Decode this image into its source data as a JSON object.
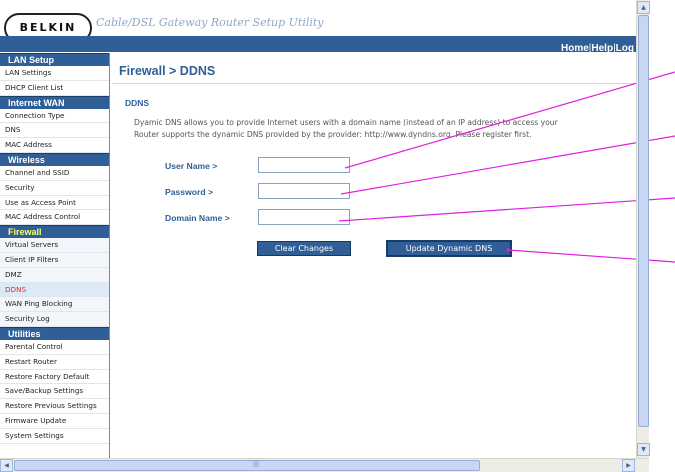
{
  "header": {
    "logo_text": "BELKIN",
    "app_title": "Cable/DSL Gateway Router Setup Utility",
    "nav": [
      "Home",
      "Help",
      "Log"
    ]
  },
  "sidebar": {
    "sections": [
      {
        "title": "LAN Setup",
        "items": [
          "LAN Settings",
          "DHCP Client List"
        ]
      },
      {
        "title": "Internet WAN",
        "items": [
          "Connection Type",
          "DNS",
          "MAC Address"
        ]
      },
      {
        "title": "Wireless",
        "items": [
          "Channel and SSID",
          "Security",
          "Use as Access Point",
          "MAC Address Control"
        ]
      },
      {
        "title": "Firewall",
        "items": [
          "Virtual Servers",
          "Client IP Filters",
          "DMZ",
          "DDNS",
          "WAN Ping Blocking",
          "Security Log"
        ]
      },
      {
        "title": "Utilities",
        "items": [
          "Parental Control",
          "Restart Router",
          "Restore Factory Default",
          "Save/Backup Settings",
          "Restore Previous Settings",
          "Firmware Update",
          "System Settings"
        ]
      }
    ],
    "active_section": "Firewall",
    "current_item": "DDNS"
  },
  "main": {
    "page_title": "Firewall > DDNS",
    "section_label": "DDNS",
    "description_line1": "Dyamic DNS allows you to provide Internet users with a domain name (instead of an IP address) to access your",
    "description_line2": "Router supports the dynamic DNS provided by the provider: http://www.dyndns.org. Please register first.",
    "fields": {
      "username_label": "User Name >",
      "username_value": "",
      "password_label": "Password >",
      "password_value": "",
      "domain_label": "Domain Name >",
      "domain_value": ""
    },
    "buttons": {
      "clear_label": "Clear Changes",
      "update_label": "Update Dynamic DNS"
    }
  },
  "colors": {
    "brand_blue": "#2f5f96",
    "annotation_magenta": "#e020e0",
    "active_section_text": "#ffff66",
    "current_item_text": "#d32f2f"
  }
}
